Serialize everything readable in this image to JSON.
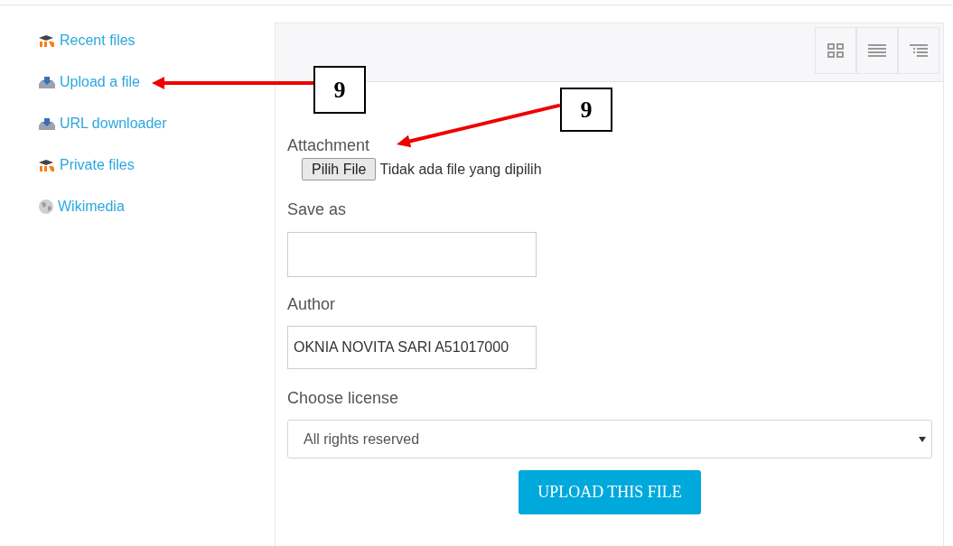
{
  "sidebar": {
    "items": [
      {
        "label": "Recent files",
        "kind": "moodle"
      },
      {
        "label": "Upload a file",
        "kind": "upload"
      },
      {
        "label": "URL downloader",
        "kind": "upload"
      },
      {
        "label": "Private files",
        "kind": "moodle"
      },
      {
        "label": "Wikimedia",
        "kind": "wiki"
      }
    ]
  },
  "view_buttons": [
    {
      "kind": "icons"
    },
    {
      "kind": "list"
    },
    {
      "kind": "tree"
    }
  ],
  "form": {
    "attachment": {
      "label": "Attachment",
      "button": "Pilih File",
      "status": "Tidak ada file yang dipilih"
    },
    "save_as": {
      "label": "Save as"
    },
    "author": {
      "label": "Author",
      "value": "OKNIA NOVITA SARI A51017000"
    },
    "license": {
      "label": "Choose license",
      "value": "All rights reserved"
    },
    "submit": "UPLOAD THIS FILE"
  },
  "callouts": [
    {
      "label": "9"
    },
    {
      "label": "9"
    }
  ]
}
